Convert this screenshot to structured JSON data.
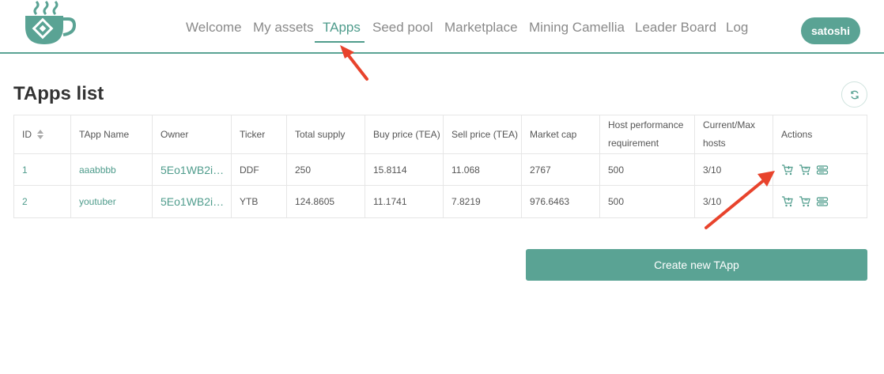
{
  "nav": {
    "items": [
      "Welcome",
      "My assets",
      "TApps",
      "Seed pool",
      "Marketplace",
      "Mining Camellia",
      "Leader Board",
      "Log"
    ],
    "active": "TApps"
  },
  "user": {
    "name": "satoshi"
  },
  "page": {
    "title": "TApps list"
  },
  "table": {
    "columns": [
      "ID",
      "TApp Name",
      "Owner",
      "Ticker",
      "Total supply",
      "Buy price (TEA)",
      "Sell price (TEA)",
      "Market cap",
      "Host performance requirement",
      "Current/Max hosts",
      "Actions"
    ],
    "rows": [
      {
        "id": "1",
        "name": "aaabbbb",
        "owner": "5Eo1WB2i…",
        "ticker": "DDF",
        "total_supply": "250",
        "buy_price": "15.8114",
        "sell_price": "11.068",
        "market_cap": "2767",
        "host_req": "500",
        "hosts": "3/10"
      },
      {
        "id": "2",
        "name": "youtuber",
        "owner": "5Eo1WB2i…",
        "ticker": "YTB",
        "total_supply": "124.8605",
        "buy_price": "11.1741",
        "sell_price": "7.8219",
        "market_cap": "976.6463",
        "host_req": "500",
        "hosts": "3/10"
      }
    ]
  },
  "actions": {
    "create_label": "Create new TApp"
  },
  "icons": [
    "teacup-logo-icon",
    "refresh-icon",
    "sort-icon",
    "buy-cart-icon",
    "sell-cart-icon",
    "host-icon"
  ],
  "colors": {
    "accent": "#5aa394",
    "link": "#4f9c8c",
    "annotation": "#e8432c"
  }
}
